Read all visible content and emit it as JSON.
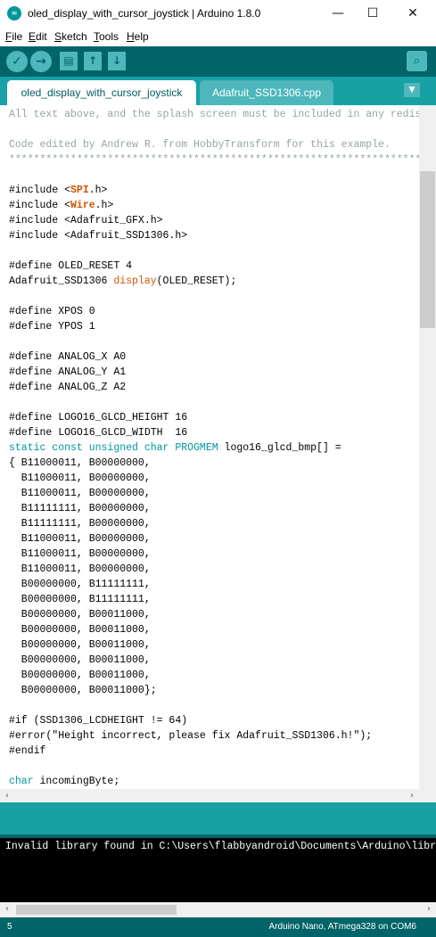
{
  "window": {
    "title": "oled_display_with_cursor_joystick | Arduino 1.8.0",
    "app_icon_text": "∞",
    "buttons": {
      "minimize": "—",
      "maximize": "☐",
      "close": "✕"
    }
  },
  "menu": {
    "items": [
      {
        "key": "F",
        "rest": "ile"
      },
      {
        "key": "E",
        "rest": "dit"
      },
      {
        "key": "S",
        "rest": "ketch"
      },
      {
        "key": "T",
        "rest": "ools"
      },
      {
        "key": "H",
        "rest": "elp"
      }
    ]
  },
  "toolbar": {
    "verify_icon": "✓",
    "upload_icon": "→",
    "new_icon": "▤",
    "open_icon": "↑",
    "save_icon": "↓",
    "serial_monitor_icon": "⌕"
  },
  "tabs": {
    "items": [
      "oled_display_with_cursor_joystick",
      "Adafruit_SSD1306.cpp"
    ],
    "active_index": 0,
    "menu_icon": "▼"
  },
  "editor": {
    "lines": [
      [
        {
          "t": "All text above, and the splash screen must be included in any redistribution",
          "c": "c-comment"
        }
      ],
      [
        {
          "t": "",
          "c": ""
        }
      ],
      [
        {
          "t": "Code edited by Andrew R. from HobbyTransform for this example.",
          "c": "c-comment"
        }
      ],
      [
        {
          "t": "*******************************************************************************",
          "c": "c-comment"
        }
      ],
      [
        {
          "t": "",
          "c": ""
        }
      ],
      [
        {
          "t": "#include <",
          "c": ""
        },
        {
          "t": "SPI",
          "c": "c-lib"
        },
        {
          "t": ".h>",
          "c": ""
        }
      ],
      [
        {
          "t": "#include <",
          "c": ""
        },
        {
          "t": "Wire",
          "c": "c-lib"
        },
        {
          "t": ".h>",
          "c": ""
        }
      ],
      [
        {
          "t": "#include <Adafruit_GFX.h>",
          "c": ""
        }
      ],
      [
        {
          "t": "#include <Adafruit_SSD1306.h>",
          "c": ""
        }
      ],
      [
        {
          "t": "",
          "c": ""
        }
      ],
      [
        {
          "t": "#define OLED_RESET 4",
          "c": ""
        }
      ],
      [
        {
          "t": "Adafruit_SSD1306 ",
          "c": ""
        },
        {
          "t": "display",
          "c": "c-fn"
        },
        {
          "t": "(OLED_RESET);",
          "c": ""
        }
      ],
      [
        {
          "t": "",
          "c": ""
        }
      ],
      [
        {
          "t": "#define XPOS 0",
          "c": ""
        }
      ],
      [
        {
          "t": "#define YPOS 1",
          "c": ""
        }
      ],
      [
        {
          "t": "",
          "c": ""
        }
      ],
      [
        {
          "t": "#define ANALOG_X A0",
          "c": ""
        }
      ],
      [
        {
          "t": "#define ANALOG_Y A1",
          "c": ""
        }
      ],
      [
        {
          "t": "#define ANALOG_Z A2",
          "c": ""
        }
      ],
      [
        {
          "t": "",
          "c": ""
        }
      ],
      [
        {
          "t": "#define LOGO16_GLCD_HEIGHT 16",
          "c": ""
        }
      ],
      [
        {
          "t": "#define LOGO16_GLCD_WIDTH  16",
          "c": ""
        }
      ],
      [
        {
          "t": "static const unsigned char PROGMEM",
          "c": "c-type"
        },
        {
          "t": " logo16_glcd_bmp[] =",
          "c": ""
        }
      ],
      [
        {
          "t": "{ B11000011, B00000000,",
          "c": ""
        }
      ],
      [
        {
          "t": "  B11000011, B00000000,",
          "c": ""
        }
      ],
      [
        {
          "t": "  B11000011, B00000000,",
          "c": ""
        }
      ],
      [
        {
          "t": "  B11111111, B00000000,",
          "c": ""
        }
      ],
      [
        {
          "t": "  B11111111, B00000000,",
          "c": ""
        }
      ],
      [
        {
          "t": "  B11000011, B00000000,",
          "c": ""
        }
      ],
      [
        {
          "t": "  B11000011, B00000000,",
          "c": ""
        }
      ],
      [
        {
          "t": "  B11000011, B00000000,",
          "c": ""
        }
      ],
      [
        {
          "t": "  B00000000, B11111111,",
          "c": ""
        }
      ],
      [
        {
          "t": "  B00000000, B11111111,",
          "c": ""
        }
      ],
      [
        {
          "t": "  B00000000, B00011000,",
          "c": ""
        }
      ],
      [
        {
          "t": "  B00000000, B00011000,",
          "c": ""
        }
      ],
      [
        {
          "t": "  B00000000, B00011000,",
          "c": ""
        }
      ],
      [
        {
          "t": "  B00000000, B00011000,",
          "c": ""
        }
      ],
      [
        {
          "t": "  B00000000, B00011000,",
          "c": ""
        }
      ],
      [
        {
          "t": "  B00000000, B00011000};",
          "c": ""
        }
      ],
      [
        {
          "t": "",
          "c": ""
        }
      ],
      [
        {
          "t": "#if (SSD1306_LCDHEIGHT != 64)",
          "c": ""
        }
      ],
      [
        {
          "t": "#error(\"Height incorrect, please fix Adafruit_SSD1306.h!\");",
          "c": ""
        }
      ],
      [
        {
          "t": "#endif",
          "c": ""
        }
      ],
      [
        {
          "t": "",
          "c": ""
        }
      ],
      [
        {
          "t": "char",
          "c": "c-type"
        },
        {
          "t": " incomingByte;",
          "c": ""
        }
      ]
    ]
  },
  "scrollbars": {
    "up": "▲",
    "down": "▼",
    "left": "‹",
    "right": "›"
  },
  "console": {
    "text": "Invalid library found in C:\\Users\\flabbyandroid\\Documents\\Arduino\\libraries"
  },
  "footer": {
    "line_number": "5",
    "board": "Arduino Nano, ATmega328 on COM6"
  },
  "colors": {
    "teal_dark": "#006468",
    "teal": "#17a1a5",
    "teal_light": "#4db7bb",
    "comment": "#95a5a6",
    "keyword_orange": "#d35400",
    "keyword_teal": "#00979c"
  }
}
